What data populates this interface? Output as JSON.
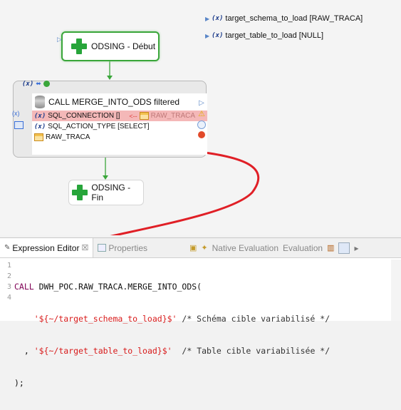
{
  "variables": [
    {
      "label": "target_schema_to_load [RAW_TRACA]"
    },
    {
      "label": "target_table_to_load [NULL]"
    }
  ],
  "nodes": {
    "start": {
      "label": "ODSING - Début"
    },
    "end": {
      "label": "ODSING - Fin"
    }
  },
  "action": {
    "header_icons": "(x)",
    "title": "CALL MERGE_INTO_ODS filtered",
    "params": [
      {
        "label": "SQL_CONNECTION []",
        "link": "RAW_TRACA",
        "arrow": "<--"
      },
      {
        "label": "SQL_ACTION_TYPE [SELECT]"
      },
      {
        "label": "RAW_TRACA"
      }
    ]
  },
  "panel": {
    "tabs": [
      {
        "label": "Expression Editor",
        "close": "☒"
      },
      {
        "label": "Properties"
      }
    ],
    "toolbar": {
      "native_evaluation": "Native Evaluation",
      "evaluation": "Evaluation"
    },
    "code": {
      "line_numbers": [
        "1",
        "2",
        "3",
        "4"
      ],
      "line1_kw": "CALL",
      "line1_rest": " DWH_POC.RAW_TRACA.MERGE_INTO_ODS(",
      "line2_str": "    '${~/target_schema_to_load}$'",
      "line2_comment": " /* Schéma cible variabilisé */",
      "line3_prefix": "  , ",
      "line3_str": "'${~/target_table_to_load}$'",
      "line3_comment": "  /* Table cible variabilisée */",
      "line4": ");"
    }
  },
  "colors": {
    "accent_green": "#27a53a",
    "error_bg": "#f4b8b8",
    "annotation_red": "#e01f26"
  },
  "icons": [
    "variable-icon",
    "plus-process-icon",
    "database-icon",
    "table-icon",
    "warning-icon",
    "error-icon",
    "play-icon",
    "close-icon"
  ]
}
